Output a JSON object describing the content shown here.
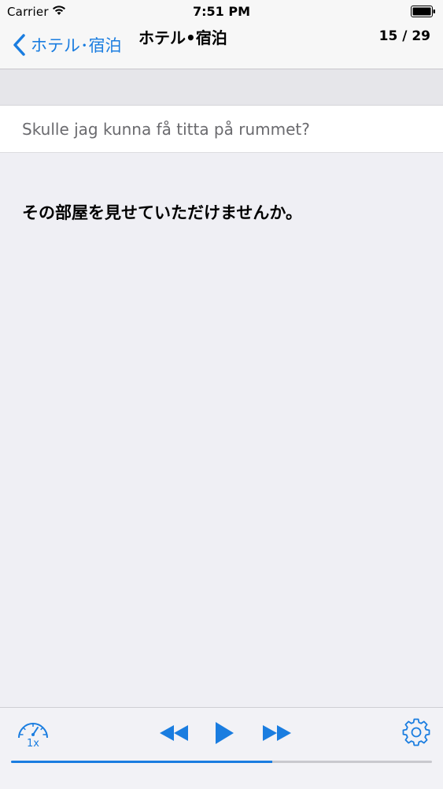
{
  "status_bar": {
    "carrier": "Carrier",
    "time": "7:51 PM"
  },
  "nav": {
    "back_label": "ホテル･宿泊",
    "title": "ホテル•宿泊",
    "counter": "15 / 29",
    "progress_fraction": 0.517
  },
  "phrase": {
    "source": "Skulle jag kunna få titta på rummet?",
    "translation": "その部屋を見せていただけませんか。"
  },
  "toolbar": {
    "speed_label": "1x",
    "playback_fraction": 0.62,
    "icons": [
      "speedometer-icon",
      "rewind-icon",
      "play-icon",
      "fast-forward-icon",
      "gear-icon"
    ]
  },
  "colors": {
    "accent": "#1a7de0",
    "background": "#efeff4",
    "card": "#ffffff",
    "secondary_text": "#6a6a6e"
  }
}
